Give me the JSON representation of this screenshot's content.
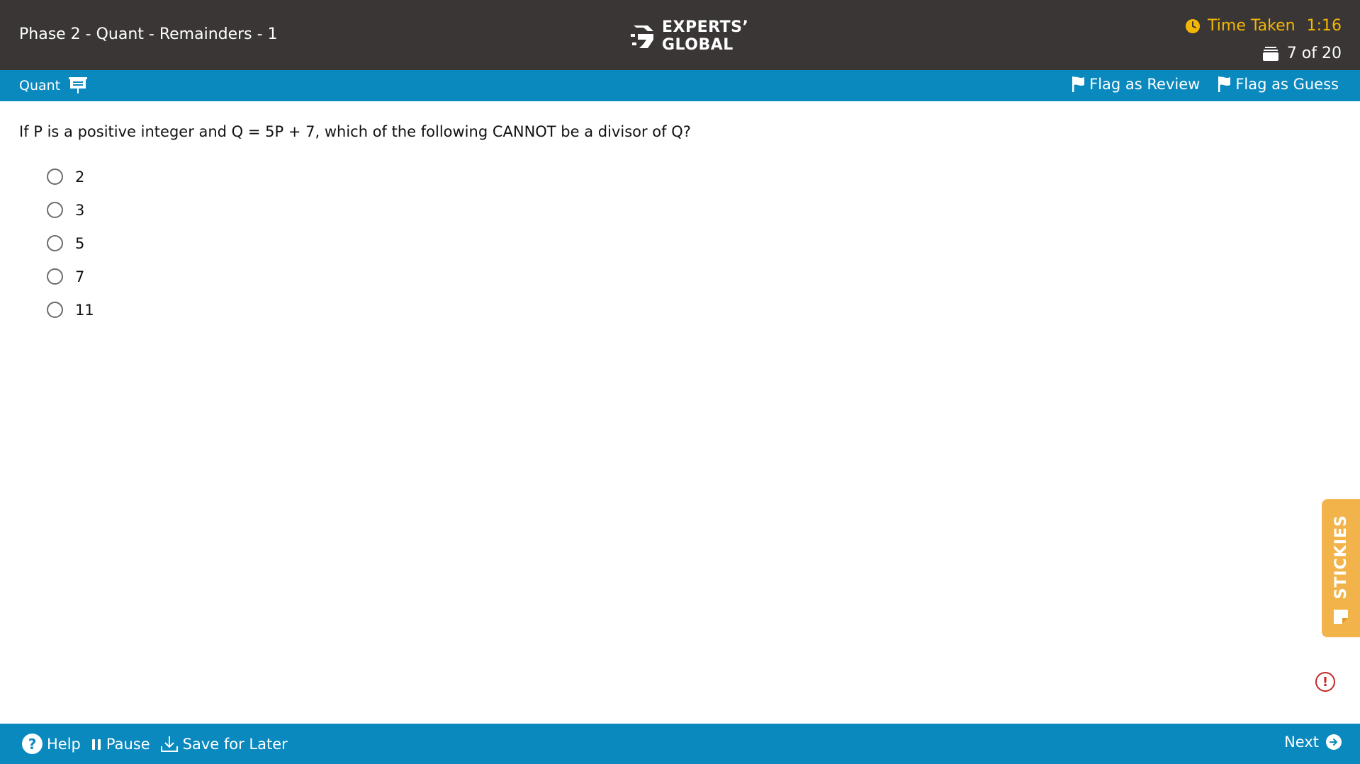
{
  "header": {
    "test_title": "Phase 2 - Quant - Remainders - 1",
    "logo_line1": "EXPERTS’",
    "logo_line2": "GLOBAL",
    "timer_label": "Time Taken",
    "timer_value": "1:16",
    "progress": "7 of 20"
  },
  "section_bar": {
    "section_name": "Quant",
    "flag_review_label": "Flag as Review",
    "flag_guess_label": "Flag as Guess"
  },
  "question": {
    "text": "If P is a positive integer and Q = 5P + 7, which of the following CANNOT be a divisor of Q?",
    "options": [
      "2",
      "3",
      "5",
      "7",
      "11"
    ]
  },
  "stickies_label": "STICKIES",
  "footer": {
    "help_label": "Help",
    "pause_label": "Pause",
    "save_label": "Save for Later",
    "next_label": "Next"
  },
  "colors": {
    "header_bg": "#3a3636",
    "accent_blue": "#0a89bf",
    "timer_yellow": "#f2b705",
    "stickies_orange": "#f2b44a",
    "alert_red": "#c62828"
  },
  "icons": {
    "timer": "clock-icon",
    "progress": "question-stack-icon",
    "section": "whiteboard-icon",
    "flag": "flag-icon",
    "help": "question-circle-icon",
    "pause": "pause-icon",
    "save": "download-icon",
    "next": "arrow-right-circle-icon",
    "alert": "exclamation-circle-icon",
    "stickies": "sticky-note-icon"
  }
}
